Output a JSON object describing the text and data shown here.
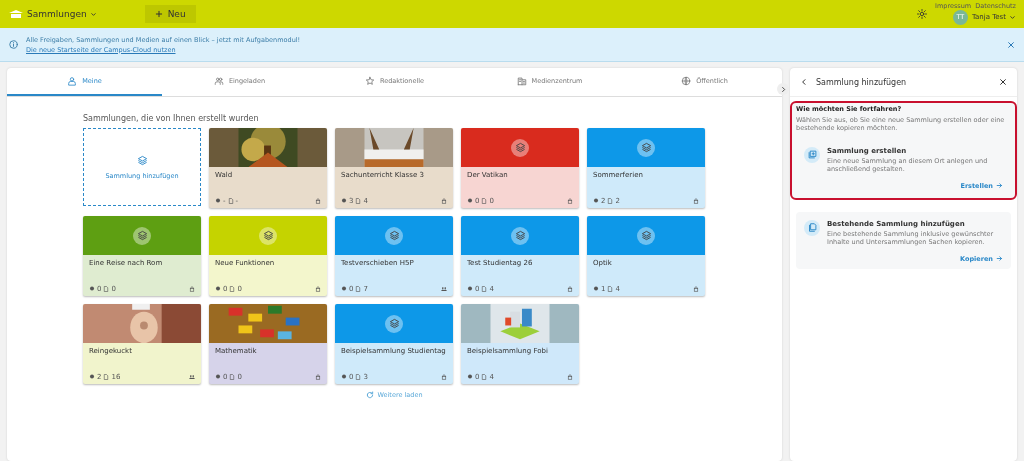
{
  "topbar": {
    "app_menu": "Sammlungen",
    "new_button": "Neu",
    "legal_links": [
      "Impressum",
      "Datenschutz"
    ],
    "user": {
      "initials": "TT",
      "name": "Tanja Test"
    }
  },
  "banner": {
    "text": "Alle Freigaben, Sammlungen und Medien auf einen Blick – jetzt mit Aufgabenmodul!",
    "link": "Die neue Startseite der Campus-Cloud nutzen"
  },
  "tabs": [
    {
      "label": "Meine",
      "selected": true
    },
    {
      "label": "Eingeladen",
      "selected": false
    },
    {
      "label": "Redaktionelle",
      "selected": false
    },
    {
      "label": "Medienzentrum",
      "selected": false
    },
    {
      "label": "Öffentlich",
      "selected": false
    }
  ],
  "section_title": "Sammlungen, die von Ihnen erstellt wurden",
  "add_card": {
    "label": "Sammlung hinzufügen"
  },
  "collections": [
    {
      "title": "Wald",
      "kind": "picture",
      "color": "#e8dccb",
      "subcollections": "-",
      "files": "-",
      "shared": false
    },
    {
      "title": "Sachunterricht Klasse 3",
      "kind": "picture",
      "color": "#e8dccb",
      "subcollections": "3",
      "files": "4",
      "shared": false
    },
    {
      "title": "Der Vatikan",
      "kind": "icon",
      "color": "#d92b1e",
      "subcollections": "0",
      "files": "0",
      "shared": false
    },
    {
      "title": "Sommerferien",
      "kind": "icon",
      "color": "#0d98e8",
      "subcollections": "2",
      "files": "2",
      "shared": false
    },
    {
      "title": "Eine Reise nach Rom",
      "kind": "icon",
      "color": "#5e9f12",
      "subcollections": "0",
      "files": "0",
      "shared": false
    },
    {
      "title": "Neue Funktionen",
      "kind": "icon",
      "color": "#c5d300",
      "subcollections": "0",
      "files": "0",
      "shared": false
    },
    {
      "title": "Testverschieben H5P",
      "kind": "icon",
      "color": "#0d98e8",
      "subcollections": "0",
      "files": "7",
      "shared": true
    },
    {
      "title": "Test Studientag 26",
      "kind": "icon",
      "color": "#0d98e8",
      "subcollections": "0",
      "files": "4",
      "shared": false
    },
    {
      "title": "Optik",
      "kind": "icon",
      "color": "#0d98e8",
      "subcollections": "1",
      "files": "4",
      "shared": false
    },
    {
      "title": "Reingekuckt",
      "kind": "picture",
      "color": "#f1f4cc",
      "subcollections": "2",
      "files": "16",
      "shared": true
    },
    {
      "title": "Mathematik",
      "kind": "picture",
      "color": "#d6d3ea",
      "subcollections": "0",
      "files": "0",
      "shared": false
    },
    {
      "title": "Beispielsammlung Studientag",
      "kind": "icon",
      "color": "#0d98e8",
      "subcollections": "0",
      "files": "3",
      "shared": false
    },
    {
      "title": "Beispielsammlung Fobi",
      "kind": "picture",
      "color": "#cfe8fa",
      "subcollections": "0",
      "files": "4",
      "shared": false
    }
  ],
  "load_more": "Weitere laden",
  "side_panel": {
    "title": "Sammlung hinzufügen",
    "question": "Wie möchten Sie fortfahren?",
    "hint": "Wählen Sie aus, ob Sie eine neue Sammlung erstellen oder eine bestehende kopieren möchten.",
    "options": [
      {
        "title": "Sammlung erstellen",
        "description": "Eine neue Sammlung an diesem Ort anlegen und anschließend gestalten.",
        "action": "Erstellen",
        "highlighted": true
      },
      {
        "title": "Bestehende Sammlung hinzufügen",
        "description": "Eine bestehende Sammlung inklusive gewünschter Inhalte und Untersammlungen Sachen kopieren.",
        "action": "Kopieren",
        "highlighted": false
      }
    ]
  }
}
